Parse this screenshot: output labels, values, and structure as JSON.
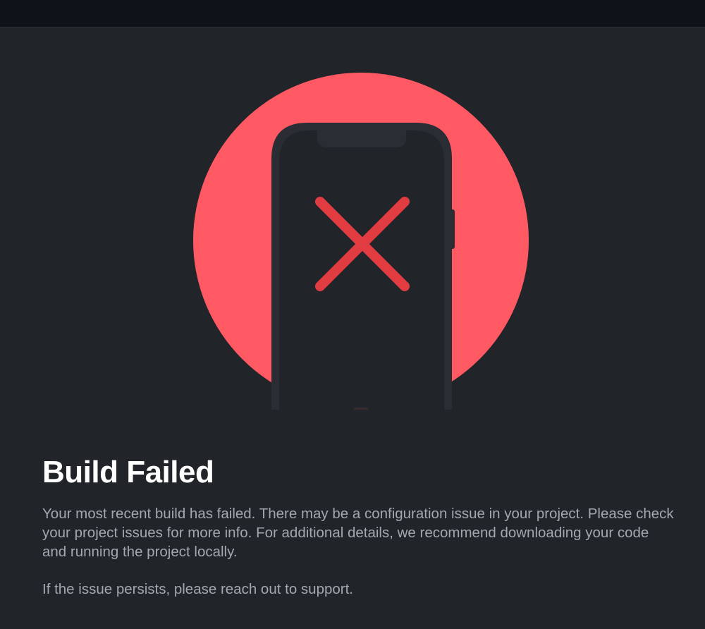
{
  "status": {
    "title": "Build Failed",
    "description": "Your most recent build has failed. There may be a configuration issue in your project. Please check your project issues for more info. For additional details, we recommend downloading your code and running the project locally.",
    "support_text": "If the issue persists, please reach out to support."
  },
  "illustration": {
    "icon": "phone-error-icon",
    "circle_color": "#ff5a63",
    "cross_color": "#e03c41",
    "phone_color": "#212428"
  }
}
